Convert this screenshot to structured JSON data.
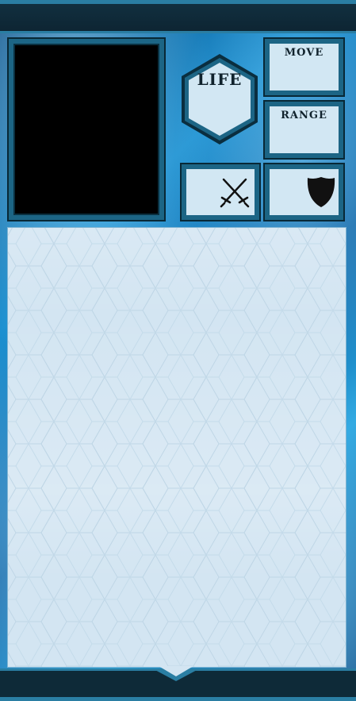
{
  "card": {
    "life_label": "LIFE",
    "move_label": "MOVE",
    "range_label": "RANGE",
    "attack_icon": "crossed-swords-icon",
    "defense_icon": "shield-icon",
    "text": ""
  },
  "colors": {
    "frame": "#1c6585",
    "frame_dark": "#082836",
    "bar": "#0e2a38",
    "bar_accent": "#2a7ea3",
    "panel": "#d3e5f2",
    "water": "#1a8fd0",
    "ink": "#10222c"
  }
}
